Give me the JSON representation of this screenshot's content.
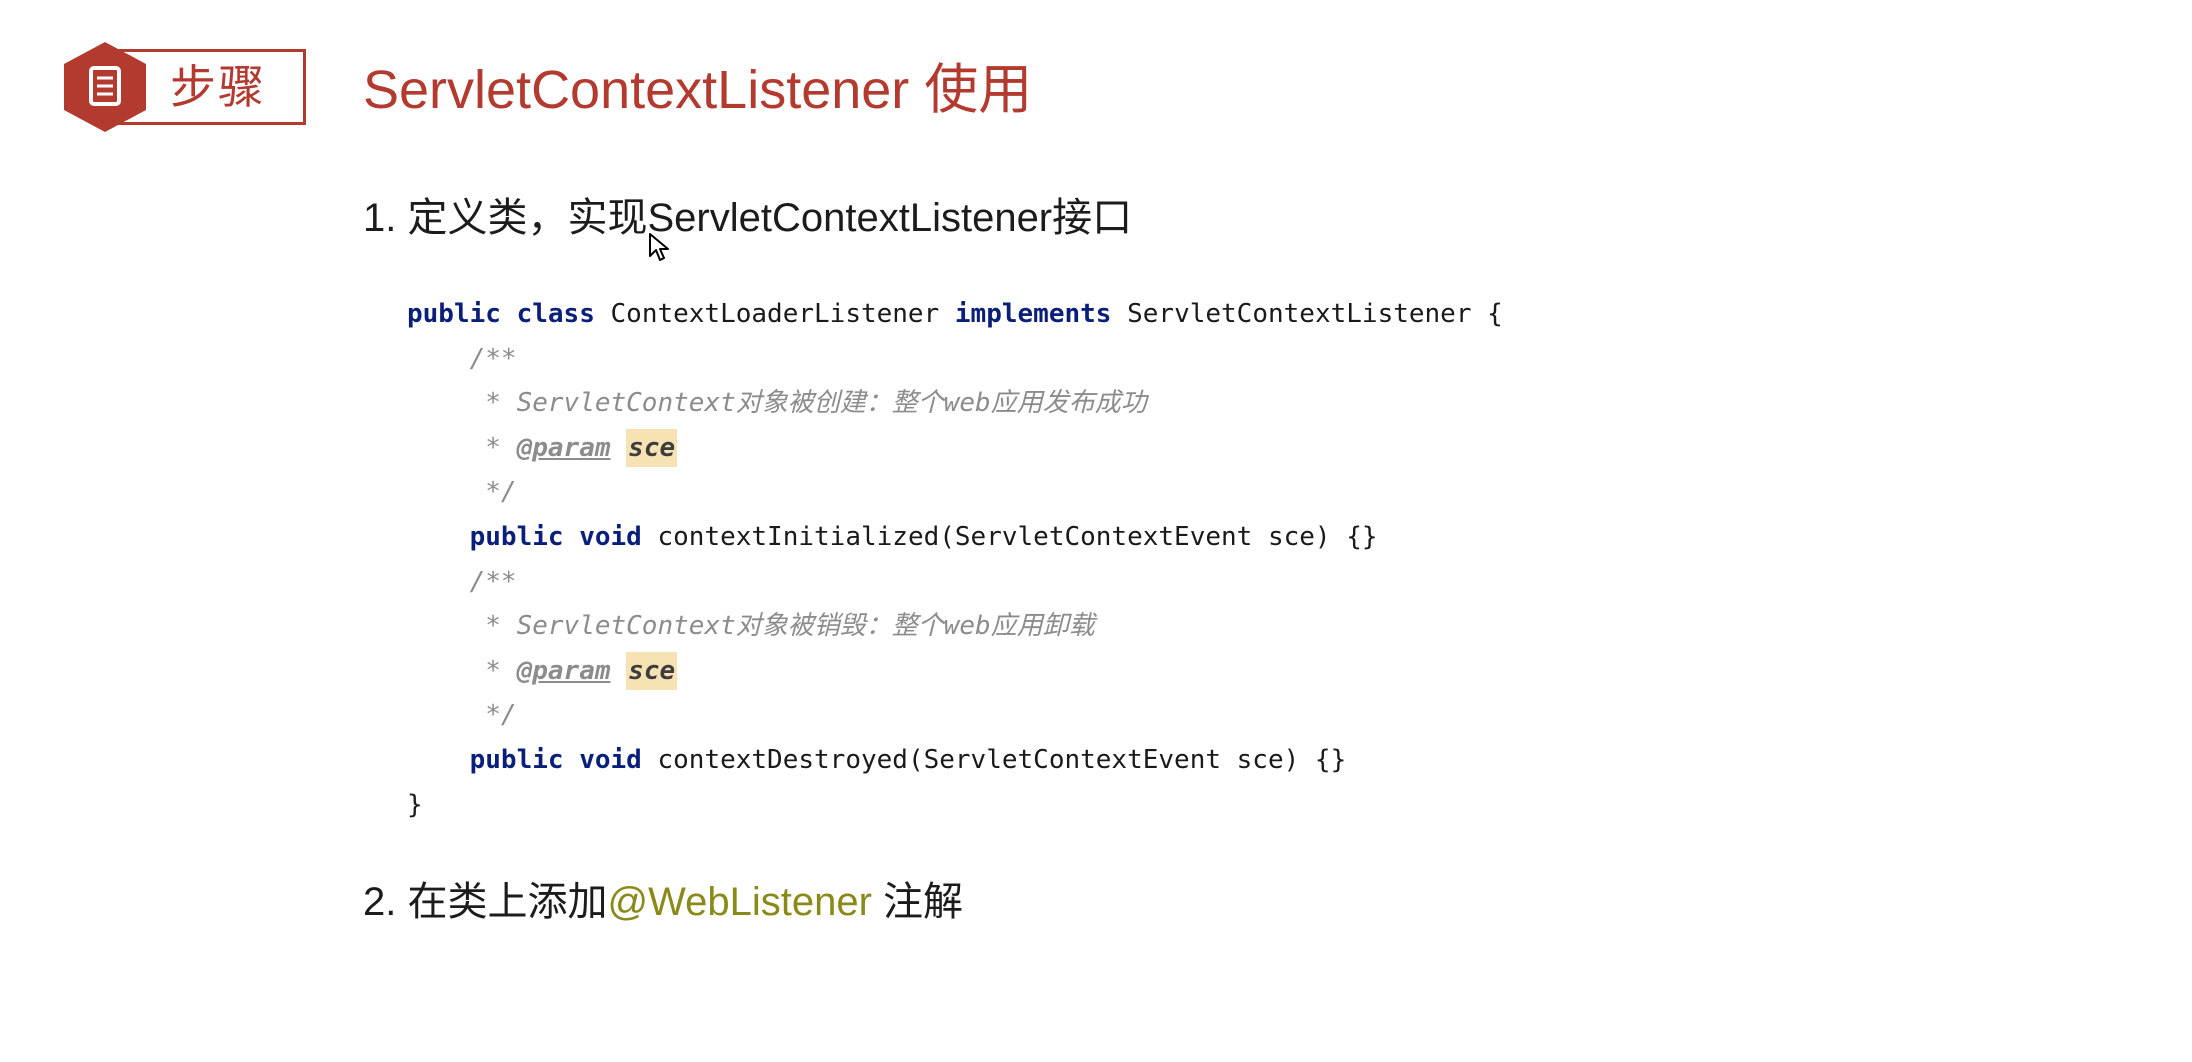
{
  "header": {
    "badge_label": "步骤",
    "title": "ServletContextListener 使用"
  },
  "steps": [
    {
      "number": "1.",
      "text": "定义类，实现ServletContextListener接口"
    },
    {
      "number": "2.",
      "text_before": "在类上添加",
      "annotation": "@WebListener",
      "text_after": " 注解"
    }
  ],
  "code": {
    "l1_kw1": "public",
    "l1_kw2": "class",
    "l1_name": "ContextLoaderListener",
    "l1_kw3": "implements",
    "l1_iface": "ServletContextListener {",
    "c1_open": "/**",
    "c1_desc": " * ServletContext对象被创建：整个web应用发布成功",
    "c1_star": " * ",
    "c1_tag": "@param",
    "c1_param": "sce",
    "c1_close": " */",
    "m1_kw1": "public",
    "m1_kw2": "void",
    "m1_sig": "contextInitialized(ServletContextEvent sce) {}",
    "c2_open": "/**",
    "c2_desc": " * ServletContext对象被销毁：整个web应用卸载",
    "c2_star": " * ",
    "c2_tag": "@param",
    "c2_param": "sce",
    "c2_close": " */",
    "m2_kw1": "public",
    "m2_kw2": "void",
    "m2_sig": "contextDestroyed(ServletContextEvent sce) {}",
    "close": "}"
  },
  "colors": {
    "accent": "#b33a2e",
    "keyword": "#0a1f7a",
    "comment": "#8c8c8c",
    "param_highlight": "#f7e2b3",
    "annotation": "#8a8a1a"
  },
  "icons": {
    "badge": "document-icon",
    "cursor": "mouse-pointer-icon"
  }
}
